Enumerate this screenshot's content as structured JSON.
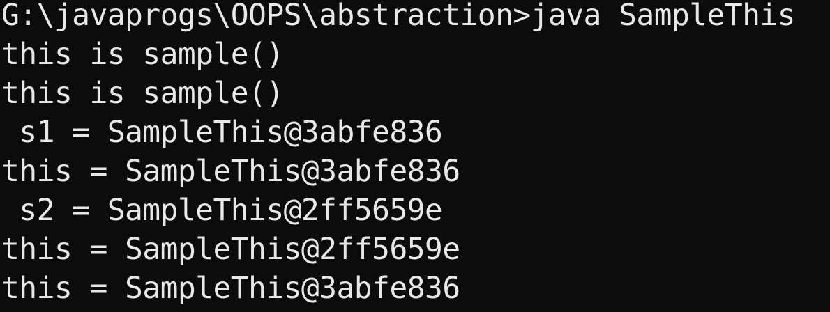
{
  "console": {
    "lines": [
      "G:\\javaprogs\\OOPS\\abstraction>java SampleThis",
      "this is sample()",
      "this is sample()",
      " s1 = SampleThis@3abfe836",
      "this = SampleThis@3abfe836",
      " s2 = SampleThis@2ff5659e",
      "this = SampleThis@2ff5659e",
      "this = SampleThis@3abfe836"
    ]
  },
  "colors": {
    "background": "#0c0c0c",
    "text": "#e8e8e8"
  }
}
